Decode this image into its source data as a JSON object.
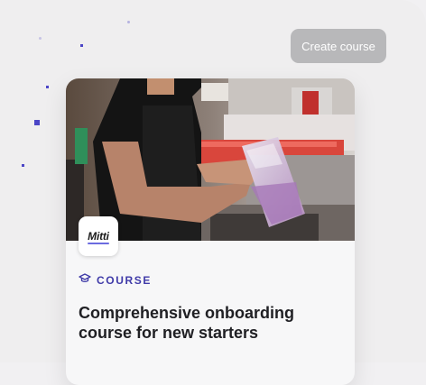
{
  "header": {
    "create_course_label": "Create course"
  },
  "card": {
    "logo_text": "Mitti",
    "category_label": "COURSE",
    "title": "Comprehensive onboarding course for new starters"
  },
  "icons": {
    "category": "graduation-cap-icon",
    "logo": "mitti-logo"
  },
  "colors": {
    "accent": "#3f3aa8",
    "button_bg": "#b8b8ba",
    "dots": "#4b45c6",
    "title": "#202024"
  }
}
